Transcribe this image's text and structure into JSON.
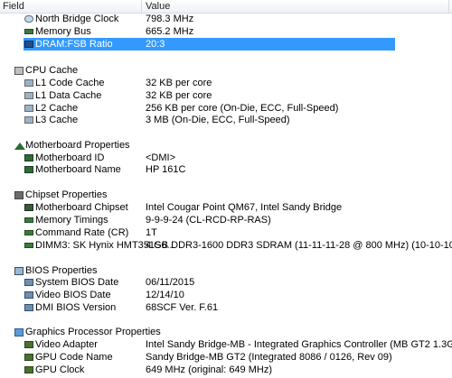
{
  "header": {
    "field": "Field",
    "value": "Value"
  },
  "rows_top": [
    {
      "label": "North Bridge Clock",
      "value": "798.3 MHz",
      "icon": "clock-icon"
    },
    {
      "label": "Memory Bus",
      "value": "665.2 MHz",
      "icon": "memory-bus-icon"
    },
    {
      "label": "DRAM:FSB Ratio",
      "value": "20:3",
      "icon": "ratio-icon",
      "selected": true
    }
  ],
  "sections": {
    "cpu_cache": {
      "title": "CPU Cache",
      "rows": [
        {
          "label": "L1 Code Cache",
          "value": "32 KB per core"
        },
        {
          "label": "L1 Data Cache",
          "value": "32 KB per core"
        },
        {
          "label": "L2 Cache",
          "value": "256 KB per core  (On-Die, ECC, Full-Speed)"
        },
        {
          "label": "L3 Cache",
          "value": "3 MB  (On-Die, ECC, Full-Speed)"
        }
      ]
    },
    "motherboard": {
      "title": "Motherboard Properties",
      "rows": [
        {
          "label": "Motherboard ID",
          "value": "<DMI>"
        },
        {
          "label": "Motherboard Name",
          "value": "HP 161C"
        }
      ]
    },
    "chipset": {
      "title": "Chipset Properties",
      "rows": [
        {
          "label": "Motherboard Chipset",
          "value": "Intel Cougar Point QM67, Intel Sandy Bridge"
        },
        {
          "label": "Memory Timings",
          "value": "9-9-9-24  (CL-RCD-RP-RAS)"
        },
        {
          "label": "Command Rate (CR)",
          "value": "1T"
        },
        {
          "label": "DIMM3: SK Hynix HMT351S6...",
          "value": "4 GB DDR3-1600 DDR3 SDRAM  (11-11-11-28 @ 800 MHz)  (10-10-10-2..."
        }
      ]
    },
    "bios": {
      "title": "BIOS Properties",
      "rows": [
        {
          "label": "System BIOS Date",
          "value": "06/11/2015"
        },
        {
          "label": "Video BIOS Date",
          "value": "12/14/10"
        },
        {
          "label": "DMI BIOS Version",
          "value": "68SCF Ver. F.61"
        }
      ]
    },
    "graphics": {
      "title": "Graphics Processor Properties",
      "rows": [
        {
          "label": "Video Adapter",
          "value": "Intel Sandy Bridge-MB - Integrated Graphics Controller (MB GT2 1.3G..."
        },
        {
          "label": "GPU Code Name",
          "value": "Sandy Bridge-MB GT2  (Integrated 8086 / 0126, Rev 09)"
        },
        {
          "label": "GPU Clock",
          "value": "649 MHz  (original: 649 MHz)"
        }
      ]
    }
  }
}
